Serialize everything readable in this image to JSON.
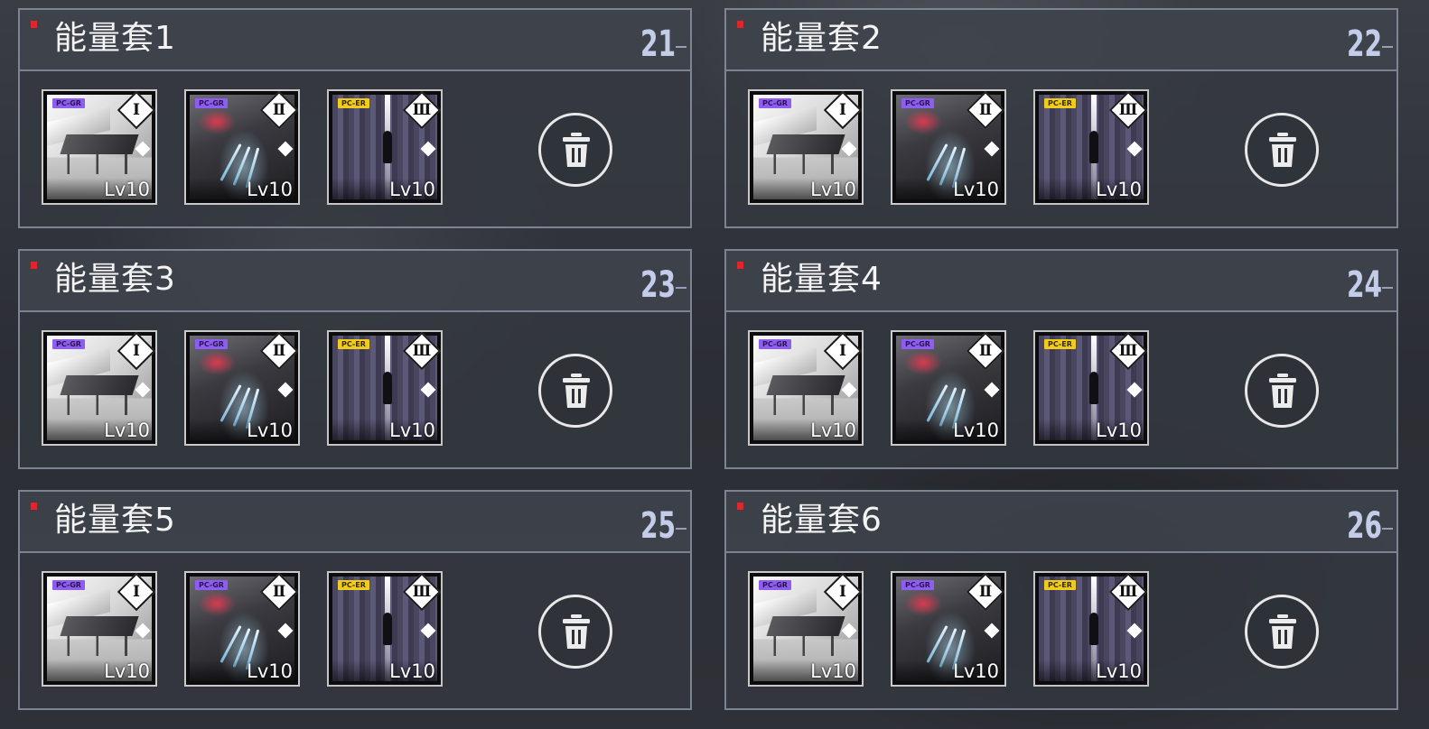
{
  "sets": [
    {
      "title": "能量套1",
      "number": "21",
      "cards": [
        {
          "tag": "PC-GR",
          "slot": "Ⅰ",
          "level": "Lv10",
          "art": "piano"
        },
        {
          "tag": "PC-GR",
          "slot": "Ⅱ",
          "level": "Lv10",
          "art": "claw"
        },
        {
          "tag": "PC-ER",
          "slot": "Ⅲ",
          "level": "Lv10",
          "art": "corridor"
        }
      ]
    },
    {
      "title": "能量套2",
      "number": "22",
      "cards": [
        {
          "tag": "PC-GR",
          "slot": "Ⅰ",
          "level": "Lv10",
          "art": "piano"
        },
        {
          "tag": "PC-GR",
          "slot": "Ⅱ",
          "level": "Lv10",
          "art": "claw"
        },
        {
          "tag": "PC-ER",
          "slot": "Ⅲ",
          "level": "Lv10",
          "art": "corridor"
        }
      ]
    },
    {
      "title": "能量套3",
      "number": "23",
      "cards": [
        {
          "tag": "PC-GR",
          "slot": "Ⅰ",
          "level": "Lv10",
          "art": "piano"
        },
        {
          "tag": "PC-GR",
          "slot": "Ⅱ",
          "level": "Lv10",
          "art": "claw"
        },
        {
          "tag": "PC-ER",
          "slot": "Ⅲ",
          "level": "Lv10",
          "art": "corridor"
        }
      ]
    },
    {
      "title": "能量套4",
      "number": "24",
      "cards": [
        {
          "tag": "PC-GR",
          "slot": "Ⅰ",
          "level": "Lv10",
          "art": "piano"
        },
        {
          "tag": "PC-GR",
          "slot": "Ⅱ",
          "level": "Lv10",
          "art": "claw"
        },
        {
          "tag": "PC-ER",
          "slot": "Ⅲ",
          "level": "Lv10",
          "art": "corridor"
        }
      ]
    },
    {
      "title": "能量套5",
      "number": "25",
      "cards": [
        {
          "tag": "PC-GR",
          "slot": "Ⅰ",
          "level": "Lv10",
          "art": "piano"
        },
        {
          "tag": "PC-GR",
          "slot": "Ⅱ",
          "level": "Lv10",
          "art": "claw"
        },
        {
          "tag": "PC-ER",
          "slot": "Ⅲ",
          "level": "Lv10",
          "art": "corridor"
        }
      ]
    },
    {
      "title": "能量套6",
      "number": "26",
      "cards": [
        {
          "tag": "PC-GR",
          "slot": "Ⅰ",
          "level": "Lv10",
          "art": "piano"
        },
        {
          "tag": "PC-GR",
          "slot": "Ⅱ",
          "level": "Lv10",
          "art": "claw"
        },
        {
          "tag": "PC-ER",
          "slot": "Ⅲ",
          "level": "Lv10",
          "art": "corridor"
        }
      ]
    }
  ],
  "icons": {
    "delete": "trash-icon",
    "lock": "lock-icon",
    "marker": "red-marker-icon"
  },
  "colors": {
    "panel_border": "#969eb0",
    "set_number": "#c3cdea",
    "marker": "#e0262c",
    "tag_gr": "#8e5ef2",
    "tag_er": "#f0cc1c"
  }
}
